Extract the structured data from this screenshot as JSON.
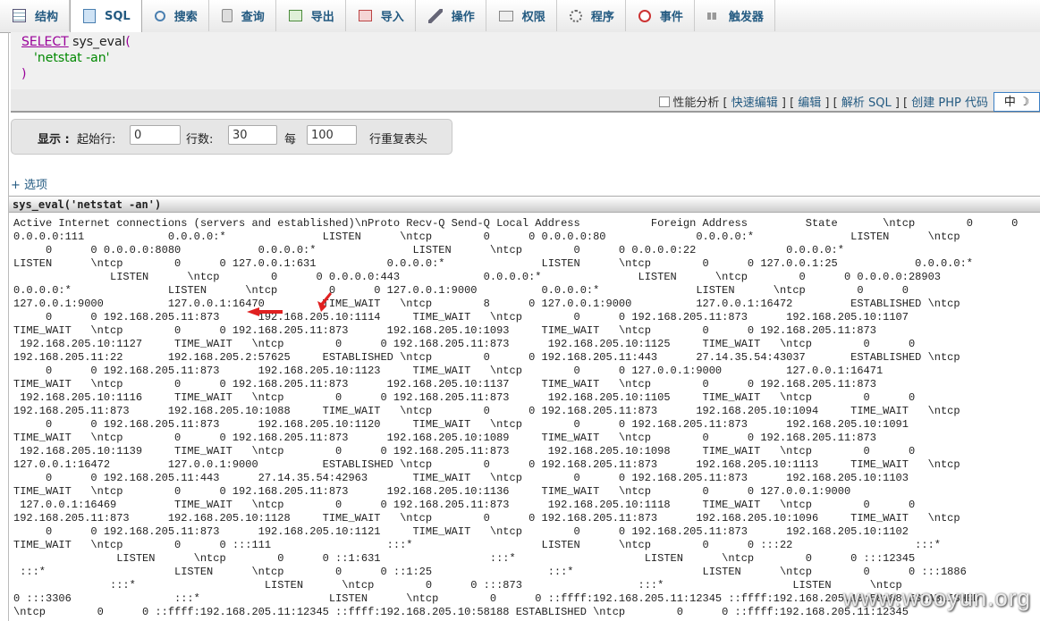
{
  "tabs": [
    {
      "label": "结构",
      "icon": "table-icon"
    },
    {
      "label": "SQL",
      "icon": "sql-icon"
    },
    {
      "label": "搜索",
      "icon": "search-icon"
    },
    {
      "label": "查询",
      "icon": "query-icon"
    },
    {
      "label": "导出",
      "icon": "export-icon"
    },
    {
      "label": "导入",
      "icon": "import-icon"
    },
    {
      "label": "操作",
      "icon": "wrench-icon"
    },
    {
      "label": "权限",
      "icon": "privileges-icon"
    },
    {
      "label": "程序",
      "icon": "routines-icon"
    },
    {
      "label": "事件",
      "icon": "events-icon"
    },
    {
      "label": "触发器",
      "icon": "triggers-icon"
    }
  ],
  "sql": {
    "keyword": "SELECT",
    "function": "sys_eval",
    "open": "(",
    "argument": "'netstat -an'",
    "close": ")"
  },
  "sql_options": {
    "profiling": "性能分析",
    "inline_edit": "快速编辑",
    "edit": "编辑",
    "explain": "解析 SQL",
    "create_php": "创建 PHP 代码",
    "ime": "中 ☽"
  },
  "navigation": {
    "show_label": "显示 :",
    "start_label": "起始行:",
    "start_value": "0",
    "rows_label": "行数:",
    "rows_value": "30",
    "every_label": "每",
    "repeat_value": "100",
    "repeat_label": "行重复表头"
  },
  "options_link": "+ 选项",
  "column_header": "sys_eval('netstat -an')",
  "result_lines": [
    "Active Internet connections (servers and established)\\nProto Recv-Q Send-Q Local Address           Foreign Address         State       \\ntcp        0      0",
    "0.0.0.0:111             0.0.0.0:*               LISTEN      \\ntcp        0      0 0.0.0.0:80              0.0.0.0:*               LISTEN      \\ntcp",
    "     0      0 0.0.0.0:8080            0.0.0.0:*               LISTEN      \\ntcp        0      0 0.0.0.0:22              0.0.0.0:*",
    "LISTEN      \\ntcp        0      0 127.0.0.1:631           0.0.0.0:*               LISTEN      \\ntcp        0      0 127.0.0.1:25            0.0.0.0:*",
    "               LISTEN      \\ntcp        0      0 0.0.0.0:443             0.0.0.0:*               LISTEN      \\ntcp        0      0 0.0.0.0:28903",
    "0.0.0.0:*               LISTEN      \\ntcp        0      0 127.0.0.1:9000          0.0.0.0:*               LISTEN      \\ntcp        0      0",
    "127.0.0.1:9000          127.0.0.1:16470         TIME_WAIT   \\ntcp        8      0 127.0.0.1:9000          127.0.0.1:16472         ESTABLISHED \\ntcp",
    "     0      0 192.168.205.11:873      192.168.205.10:1114     TIME_WAIT   \\ntcp        0      0 192.168.205.11:873      192.168.205.10:1107",
    "TIME_WAIT   \\ntcp        0      0 192.168.205.11:873      192.168.205.10:1093     TIME_WAIT   \\ntcp        0      0 192.168.205.11:873",
    " 192.168.205.10:1127     TIME_WAIT   \\ntcp        0      0 192.168.205.11:873      192.168.205.10:1125     TIME_WAIT   \\ntcp        0      0",
    "192.168.205.11:22       192.168.205.2:57625     ESTABLISHED \\ntcp        0      0 192.168.205.11:443      27.14.35.54:43037       ESTABLISHED \\ntcp",
    "     0      0 192.168.205.11:873      192.168.205.10:1123     TIME_WAIT   \\ntcp        0      0 127.0.0.1:9000          127.0.0.1:16471",
    "TIME_WAIT   \\ntcp        0      0 192.168.205.11:873      192.168.205.10:1137     TIME_WAIT   \\ntcp        0      0 192.168.205.11:873",
    " 192.168.205.10:1116     TIME_WAIT   \\ntcp        0      0 192.168.205.11:873      192.168.205.10:1105     TIME_WAIT   \\ntcp        0      0",
    "192.168.205.11:873      192.168.205.10:1088     TIME_WAIT   \\ntcp        0      0 192.168.205.11:873      192.168.205.10:1094     TIME_WAIT   \\ntcp",
    "     0      0 192.168.205.11:873      192.168.205.10:1120     TIME_WAIT   \\ntcp        0      0 192.168.205.11:873      192.168.205.10:1091",
    "TIME_WAIT   \\ntcp        0      0 192.168.205.11:873      192.168.205.10:1089     TIME_WAIT   \\ntcp        0      0 192.168.205.11:873",
    " 192.168.205.10:1139     TIME_WAIT   \\ntcp        0      0 192.168.205.11:873      192.168.205.10:1098     TIME_WAIT   \\ntcp        0      0",
    "127.0.0.1:16472         127.0.0.1:9000          ESTABLISHED \\ntcp        0      0 192.168.205.11:873      192.168.205.10:1113     TIME_WAIT   \\ntcp",
    "     0      0 192.168.205.11:443      27.14.35.54:42963       TIME_WAIT   \\ntcp        0      0 192.168.205.11:873      192.168.205.10:1103",
    "TIME_WAIT   \\ntcp        0      0 192.168.205.11:873      192.168.205.10:1136     TIME_WAIT   \\ntcp        0      0 127.0.0.1:9000",
    " 127.0.0.1:16469         TIME_WAIT   \\ntcp        0      0 192.168.205.11:873      192.168.205.10:1118     TIME_WAIT   \\ntcp        0      0",
    "192.168.205.11:873      192.168.205.10:1128     TIME_WAIT   \\ntcp        0      0 192.168.205.11:873      192.168.205.10:1096     TIME_WAIT   \\ntcp",
    "     0      0 192.168.205.11:873      192.168.205.10:1121     TIME_WAIT   \\ntcp        0      0 192.168.205.11:873      192.168.205.10:1102",
    "TIME_WAIT   \\ntcp        0      0 :::111                  :::*                    LISTEN      \\ntcp        0      0 :::22                   :::*",
    "                LISTEN      \\ntcp        0      0 ::1:631                 :::*                    LISTEN      \\ntcp        0      0 :::12345",
    " :::*                    LISTEN      \\ntcp        0      0 ::1:25                  :::*                    LISTEN      \\ntcp        0      0 :::1886",
    "               :::*                    LISTEN      \\ntcp        0      0 :::873                  :::*                    LISTEN      \\ntcp",
    "0 :::3306                :::*                    LISTEN      \\ntcp        0      0 ::ffff:192.168.205.11:12345 ::ffff:192.168.205.10:58188 ESTABLISHED",
    "\\ntcp        0      0 ::ffff:192.168.205.11:12345 ::ffff:192.168.205.10:58188 ESTABLISHED \\ntcp        0      0 ::ffff:192.168.205.11:12345"
  ],
  "watermark": "www.wooyun.org",
  "colors": {
    "link": "#235a81",
    "keyword": "#990099",
    "string": "#008800",
    "arrow": "#e02020"
  }
}
